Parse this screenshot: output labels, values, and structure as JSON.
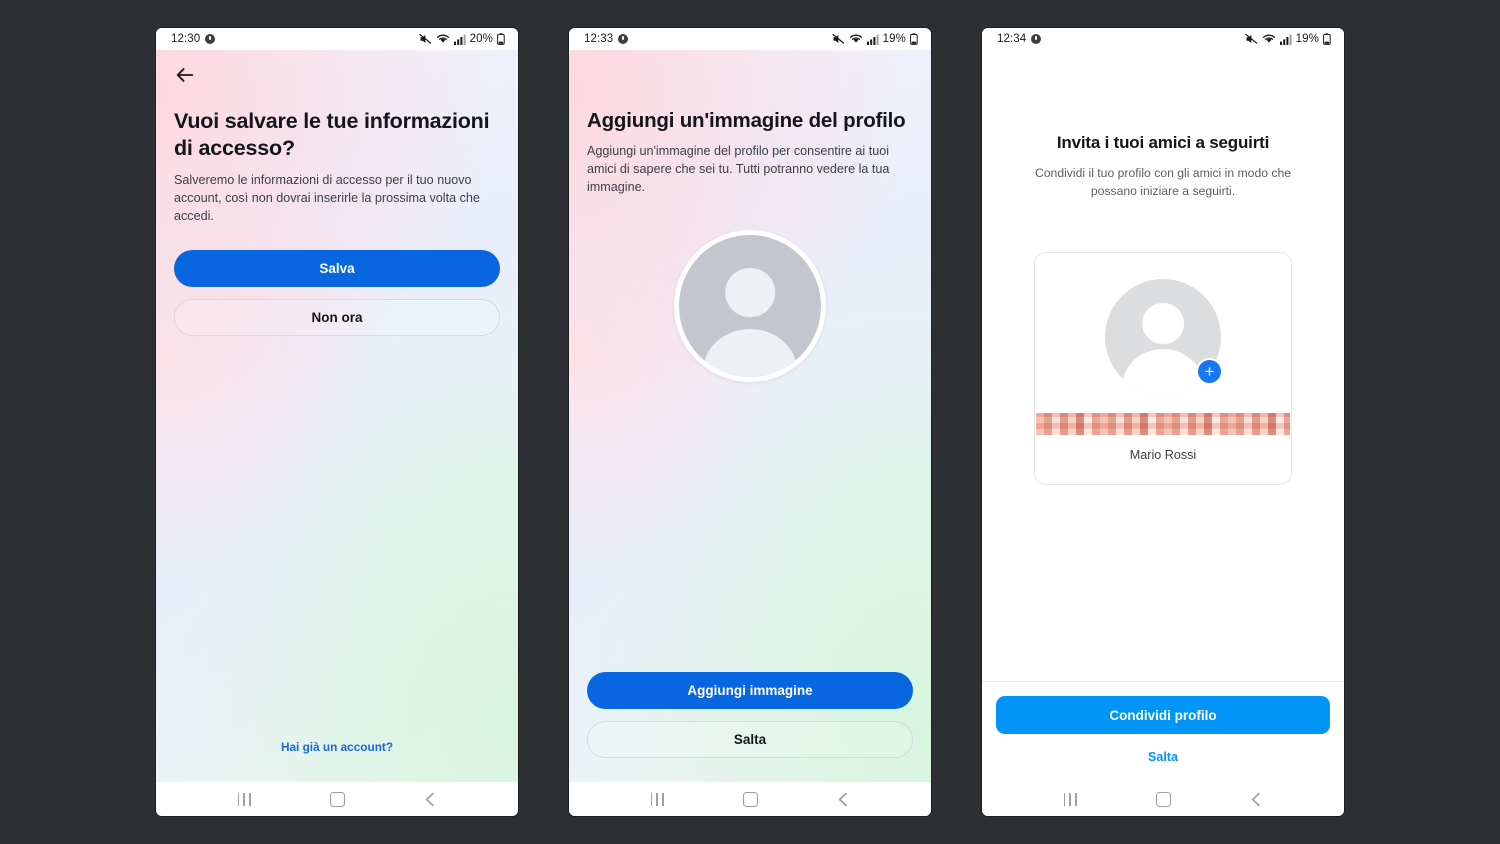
{
  "theme": {
    "page_background": "#2d3033",
    "facebook_blue": "#0866e0",
    "instagram_blue": "#0095f6",
    "link_blue": "#1a68d6",
    "badge_blue": "#1877f2",
    "heading_color": "#14161a"
  },
  "screens": [
    {
      "id": "save-login-info",
      "statusbar": {
        "time": "12:30",
        "battery_percent": "20%",
        "icons": [
          "mute-icon",
          "wifi-icon",
          "signal-icon",
          "battery-icon"
        ]
      },
      "back_button": "back-arrow",
      "title": "Vuoi salvare le tue informazioni di accesso?",
      "subtitle": "Salveremo le informazioni di accesso per il tuo nuovo account, così non dovrai inserirle la prossima volta che accedi.",
      "primary_button": "Salva",
      "secondary_button": "Non ora",
      "footer_link": "Hai già un account?"
    },
    {
      "id": "add-profile-picture",
      "statusbar": {
        "time": "12:33",
        "battery_percent": "19%",
        "icons": [
          "mute-icon",
          "wifi-icon",
          "signal-icon",
          "battery-icon"
        ]
      },
      "title": "Aggiungi un'immagine del profilo",
      "subtitle": "Aggiungi un'immagine del profilo per consentire ai tuoi amici di sapere che sei tu. Tutti potranno vedere la tua immagine.",
      "avatar": "default-avatar-placeholder",
      "primary_button": "Aggiungi immagine",
      "secondary_button": "Salta"
    },
    {
      "id": "invite-friends",
      "statusbar": {
        "time": "12:34",
        "battery_percent": "19%",
        "icons": [
          "mute-icon",
          "wifi-icon",
          "signal-icon",
          "battery-icon"
        ]
      },
      "title": "Invita i tuoi amici a seguirti",
      "subtitle": "Condividi il tuo profilo con gli amici in modo che possano iniziare a seguirti.",
      "card": {
        "avatar": "default-avatar-placeholder",
        "add_badge": "plus-icon",
        "username_redacted": "",
        "display_name": "Mario Rossi"
      },
      "primary_button": "Condividi profilo",
      "skip_link": "Salta"
    }
  ],
  "navbar": {
    "recents": "recents-icon",
    "home": "home-icon",
    "back": "back-icon"
  }
}
